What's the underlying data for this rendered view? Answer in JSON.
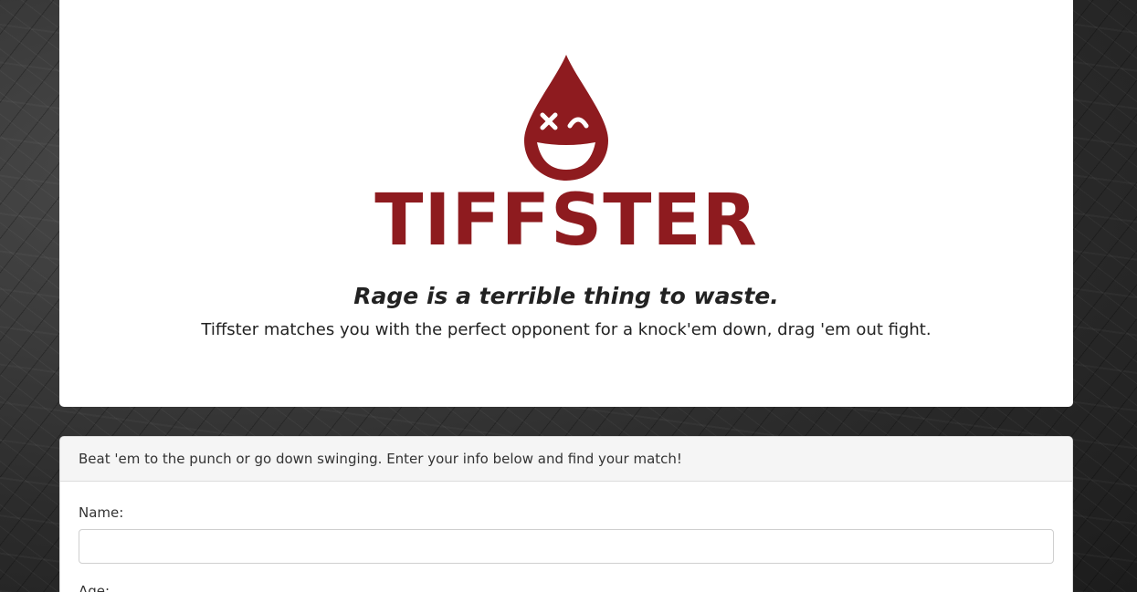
{
  "brand": {
    "name": "TIFFSTER",
    "logo_color": "#8e1b1f"
  },
  "hero": {
    "headline": "Rage is a terrible thing to waste.",
    "subline": "Tiffster matches you with the perfect opponent for a knock'em down, drag 'em out fight."
  },
  "form": {
    "header": "Beat 'em to the punch or go down swinging. Enter your info below and find your match!",
    "name_label": "Name:",
    "name_value": "",
    "age_label": "Age:"
  }
}
